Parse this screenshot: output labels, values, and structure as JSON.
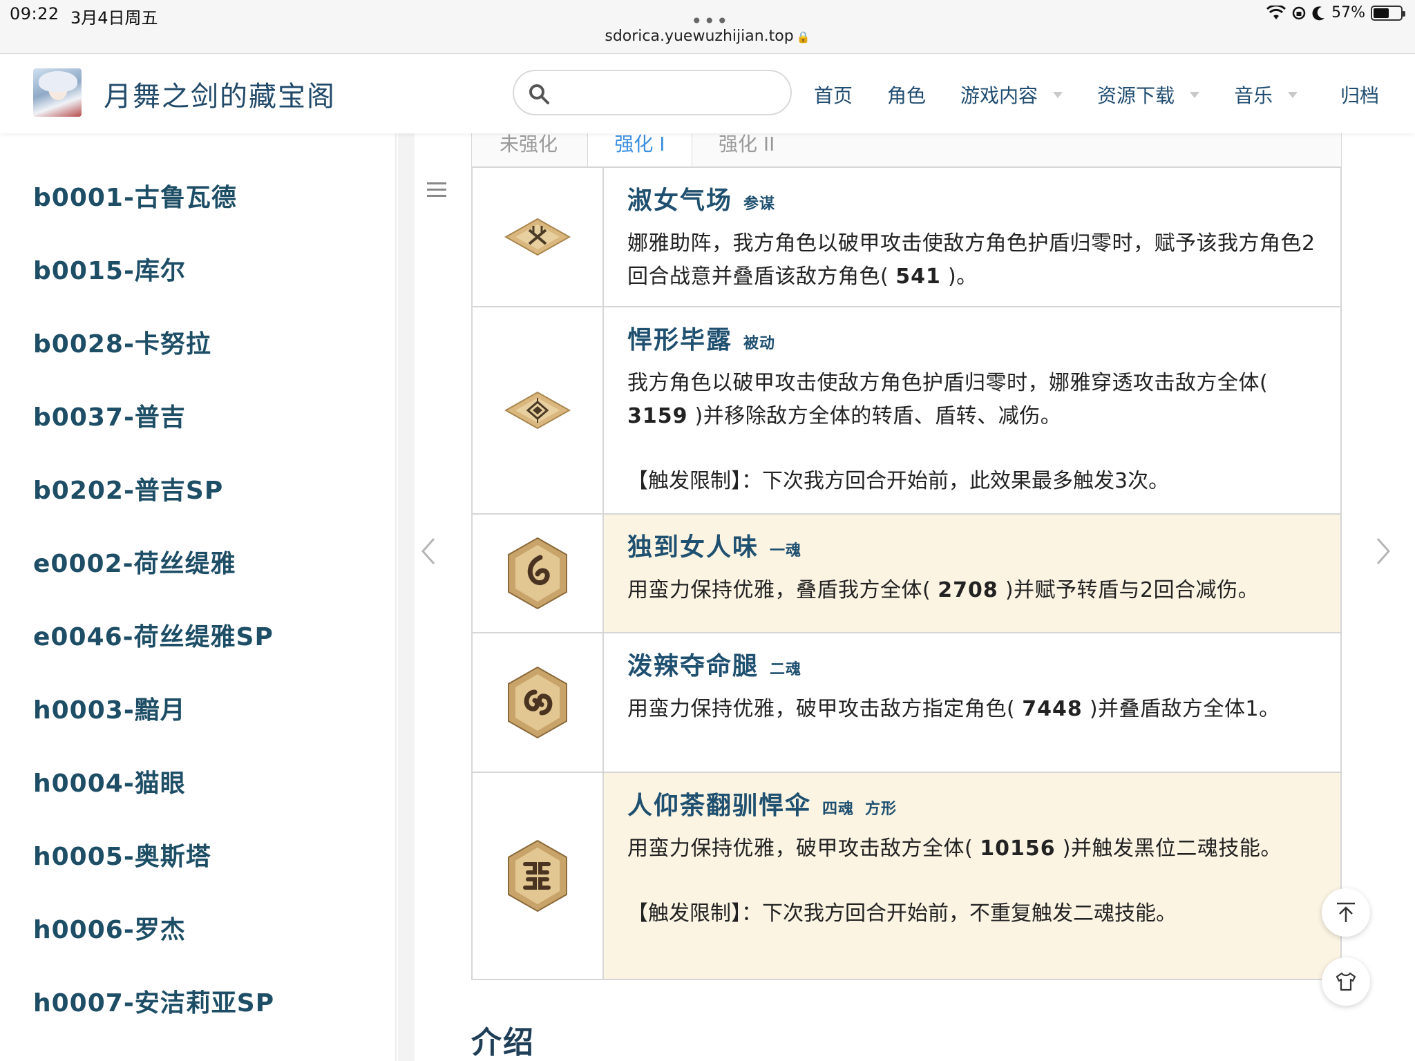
{
  "status_bar": {
    "time": "09:22",
    "date": "3月4日周五",
    "url": "sdorica.yuewuzhijian.top",
    "battery": "57%",
    "battery_level": 0.57
  },
  "header": {
    "site_title": "月舞之剑的藏宝阁",
    "search_placeholder": "",
    "nav": [
      {
        "label": "首页"
      },
      {
        "label": "角色"
      },
      {
        "label": "游戏内容"
      },
      {
        "label": "资源下载"
      },
      {
        "label": "音乐"
      },
      {
        "label": "归档"
      }
    ]
  },
  "sidebar": {
    "items": [
      "b0001-古鲁瓦德",
      "b0015-库尔",
      "b0028-卡努拉",
      "b0037-普吉",
      "b0202-普吉SP",
      "e0002-荷丝缇雅",
      "e0046-荷丝缇雅SP",
      "h0003-黯月",
      "h0004-猫眼",
      "h0005-奥斯塔",
      "h0006-罗杰",
      "h0007-安洁莉亚SP"
    ]
  },
  "tabs": [
    "未强化",
    "强化 I",
    "强化 II"
  ],
  "active_tab": "强化 I",
  "skills": [
    {
      "name": "淑女气场",
      "tag": "参谋",
      "desc_pre": "娜雅助阵，我方角色以破甲攻击使敌方角色护盾归零时，赋予该我方角色2回合战意并叠盾该敌方角色(",
      "value": "541",
      "desc_post": ")。",
      "limit": "",
      "icon": "crossed-swords-diamond-icon"
    },
    {
      "name": "悍形毕露",
      "tag": "被动",
      "desc_pre": "我方角色以破甲攻击使敌方角色护盾归零时，娜雅穿透攻击敌方全体(",
      "value": "3159",
      "desc_post": ")并移除敌方全体的转盾、盾转、减伤。",
      "limit": "【触发限制】：下次我方回合开始前，此效果最多触发3次。",
      "icon": "emblem-diamond-icon"
    },
    {
      "name": "独到女人味",
      "tag": "一魂",
      "desc_pre": "用蛮力保持优雅，叠盾我方全体(",
      "value": "2708",
      "desc_post": ")并赋予转盾与2回合减伤。",
      "limit": "",
      "icon": "one-soul-hex-icon"
    },
    {
      "name": "泼辣夺命腿",
      "tag": "二魂",
      "desc_pre": "用蛮力保持优雅，破甲攻击敌方指定角色(",
      "value": "7448",
      "desc_post": ")并叠盾敌方全体1。",
      "limit": "",
      "icon": "two-soul-hex-icon"
    },
    {
      "name": "人仰荼翻驯悍伞",
      "tag": "四魂",
      "tag2": "方形",
      "desc_pre": "用蛮力保持优雅，破甲攻击敌方全体(",
      "value": "10156",
      "desc_post": ")并触发黑位二魂技能。",
      "limit": "【触发限制】：下次我方回合开始前，不重复触发二魂技能。",
      "icon": "four-soul-hex-icon"
    }
  ],
  "section_title": "介绍",
  "colors": {
    "title": "#214a6a",
    "sidebar_text": "#1d4e66",
    "active_tab": "#3b8fe0",
    "soul_row_bg": "#fbf4e3",
    "border": "#d6d6d6"
  }
}
